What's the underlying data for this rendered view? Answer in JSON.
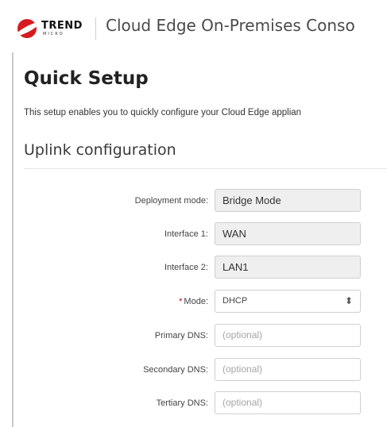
{
  "header": {
    "logo_text": "TREND",
    "logo_subtext": "MICRO",
    "app_title": "Cloud Edge On-Premises Conso"
  },
  "page": {
    "title": "Quick Setup",
    "description": "This setup enables you to quickly configure your Cloud Edge applian"
  },
  "section": {
    "title": "Uplink configuration"
  },
  "form": {
    "deployment_mode": {
      "label": "Deployment mode:",
      "value": "Bridge Mode"
    },
    "interface1": {
      "label": "Interface 1:",
      "value": "WAN"
    },
    "interface2": {
      "label": "Interface 2:",
      "value": "LAN1"
    },
    "mode": {
      "required_mark": "*",
      "label": "Mode:",
      "value": "DHCP"
    },
    "primary_dns": {
      "label": "Primary DNS:",
      "placeholder": "(optional)"
    },
    "secondary_dns": {
      "label": "Secondary DNS:",
      "placeholder": "(optional)"
    },
    "tertiary_dns": {
      "label": "Tertiary DNS:",
      "placeholder": "(optional)"
    }
  },
  "icons": {
    "logo": "trend-micro-logo",
    "select_arrows": "updown-arrows-icon"
  },
  "colors": {
    "brand_red": "#d71920",
    "required_red": "#d0021b",
    "pointer_blue": "#8ab6e3"
  }
}
